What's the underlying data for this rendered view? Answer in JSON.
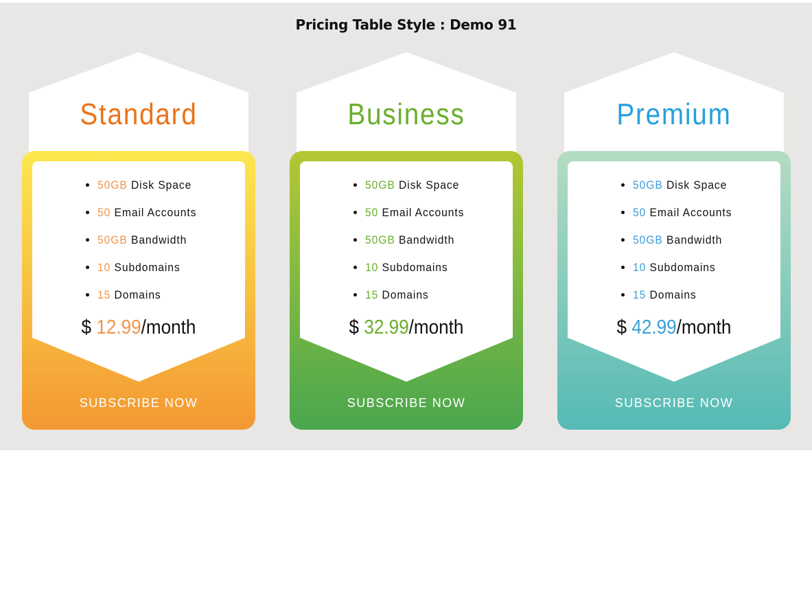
{
  "page": {
    "title": "Pricing Table Style : Demo 91",
    "background": "#e8e7e5"
  },
  "plans": [
    {
      "name": "Standard",
      "accent": "#ea7317",
      "value_color": "#f0954a",
      "features": [
        {
          "value": "50GB",
          "label": "Disk Space"
        },
        {
          "value": "50",
          "label": "Email Accounts"
        },
        {
          "value": "50GB",
          "label": "Bandwidth"
        },
        {
          "value": "10",
          "label": "Subdomains"
        },
        {
          "value": "15",
          "label": "Domains"
        }
      ],
      "currency": "$",
      "price": "12.99",
      "period": "/month",
      "cta": "SUBSCRIBE NOW"
    },
    {
      "name": "Business",
      "accent": "#6aaf2c",
      "value_color": "#6aaf2c",
      "features": [
        {
          "value": "50GB",
          "label": "Disk Space"
        },
        {
          "value": "50",
          "label": "Email Accounts"
        },
        {
          "value": "50GB",
          "label": "Bandwidth"
        },
        {
          "value": "10",
          "label": "Subdomains"
        },
        {
          "value": "15",
          "label": "Domains"
        }
      ],
      "currency": "$",
      "price": "32.99",
      "period": "/month",
      "cta": "SUBSCRIBE NOW"
    },
    {
      "name": "Premium",
      "accent": "#279fdc",
      "value_color": "#3a9fd6",
      "features": [
        {
          "value": "50GB",
          "label": "Disk Space"
        },
        {
          "value": "50",
          "label": "Email Accounts"
        },
        {
          "value": "50GB",
          "label": "Bandwidth"
        },
        {
          "value": "10",
          "label": "Subdomains"
        },
        {
          "value": "15",
          "label": "Domains"
        }
      ],
      "currency": "$",
      "price": "42.99",
      "period": "/month",
      "cta": "SUBSCRIBE NOW"
    }
  ]
}
